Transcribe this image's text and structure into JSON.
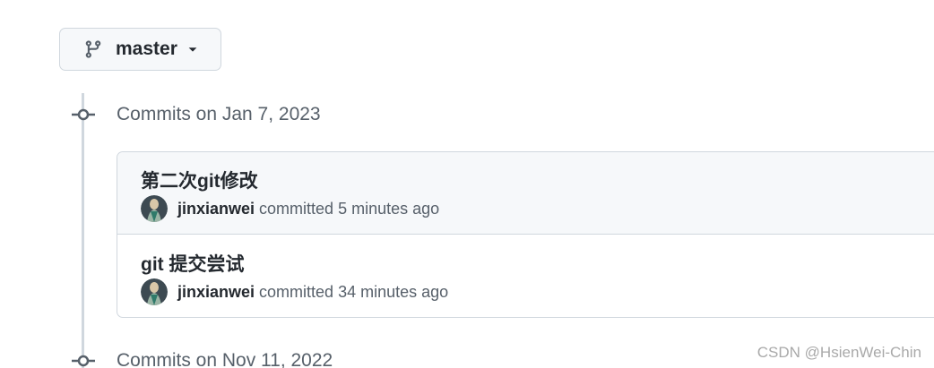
{
  "branch_selector": {
    "branch_name": "master",
    "icon": "git-branch-icon",
    "dropdown_icon": "triangle-down-icon"
  },
  "commit_groups": [
    {
      "date_label": "Commits on Jan 7, 2023",
      "commits": [
        {
          "title": "第二次git修改",
          "author": "jinxianwei",
          "action": "committed",
          "time": "5 minutes ago"
        },
        {
          "title": "git 提交尝试",
          "author": "jinxianwei",
          "action": "committed",
          "time": "34 minutes ago"
        }
      ]
    },
    {
      "date_label": "Commits on Nov 11, 2022",
      "commits": []
    }
  ],
  "watermark": "CSDN @HsienWei-Chin",
  "colors": {
    "border": "#d0d7de",
    "muted_text": "#57606a",
    "primary_text": "#24292f",
    "row_highlight": "#f6f8fa"
  }
}
